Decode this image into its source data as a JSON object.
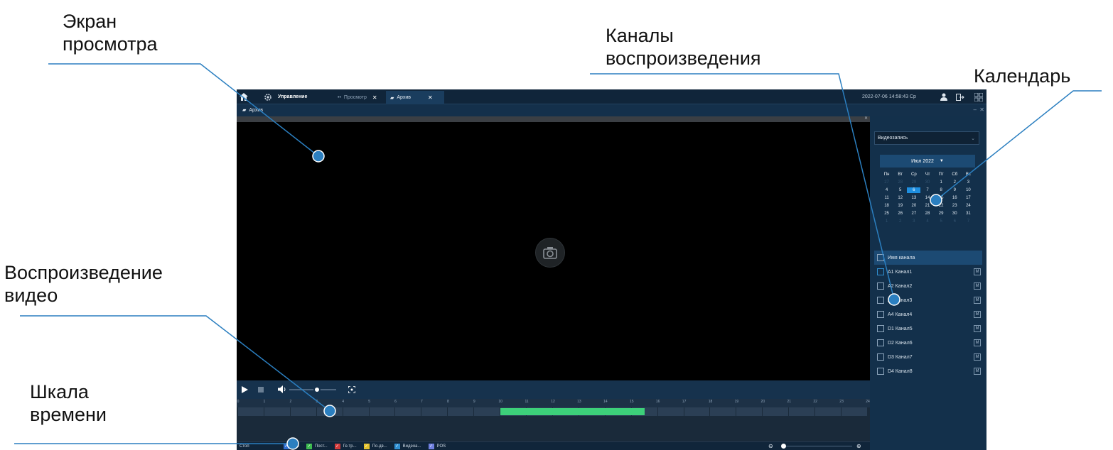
{
  "annotations": {
    "viewer": [
      "Экран",
      "просмотра"
    ],
    "channels": [
      "Каналы",
      "воспроизведения"
    ],
    "calendar": [
      "Календарь"
    ],
    "playback": [
      "Воспроизведение",
      "видео"
    ],
    "timeline": [
      "Шкала",
      "времени"
    ]
  },
  "topbar": {
    "manage_label": "Управление",
    "tab_view": "Просмотр",
    "tab_archive": "Архив",
    "datetime": "2022-07-06 14:58:43 Ср"
  },
  "subbar": {
    "title": "Архив"
  },
  "panel": {
    "record_type": "Видеозапись",
    "calendar": {
      "month": "Июл 2022",
      "weekdays": [
        "Пн",
        "Вт",
        "Ср",
        "Чт",
        "Пт",
        "Сб",
        "Вс"
      ],
      "weeks": [
        [
          "27",
          "28",
          "29",
          "30",
          "1",
          "2",
          "3"
        ],
        [
          "4",
          "5",
          "6",
          "7",
          "8",
          "9",
          "10"
        ],
        [
          "11",
          "12",
          "13",
          "14",
          "15",
          "16",
          "17"
        ],
        [
          "18",
          "19",
          "20",
          "21",
          "22",
          "23",
          "24"
        ],
        [
          "25",
          "26",
          "27",
          "28",
          "29",
          "30",
          "31"
        ],
        [
          "1",
          "2",
          "3",
          "4",
          "5",
          "6",
          "7"
        ]
      ],
      "selected_day": "6"
    },
    "channel_header": "Имя канала",
    "channels": [
      "A1 Канал1",
      "A2 Канал2",
      "A3 Канал3",
      "A4 Канал4",
      "D1 Канал5",
      "D2 Канал6",
      "D3 Канал7",
      "D4 Канал8"
    ],
    "channel_button": "M"
  },
  "timeline": {
    "hours": [
      "0",
      "1",
      "2",
      "3",
      "4",
      "5",
      "6",
      "7",
      "8",
      "9",
      "10",
      "11",
      "12",
      "13",
      "14",
      "15",
      "16",
      "17",
      "18",
      "19",
      "20",
      "21",
      "22",
      "23",
      "24"
    ],
    "recording_hours": [
      10,
      15.5
    ]
  },
  "legend": {
    "speed_label": "Стоп",
    "items": [
      {
        "label": "Все",
        "color": "#2f6fd1"
      },
      {
        "label": "Пост...",
        "color": "#3dbb4f"
      },
      {
        "label": "Ге.тр...",
        "color": "#d23a3a"
      },
      {
        "label": "По.дв...",
        "color": "#e3c22c"
      },
      {
        "label": "Видеоа...",
        "color": "#2f8fd1"
      },
      {
        "label": "POS",
        "color": "#6f7fe0"
      }
    ]
  }
}
